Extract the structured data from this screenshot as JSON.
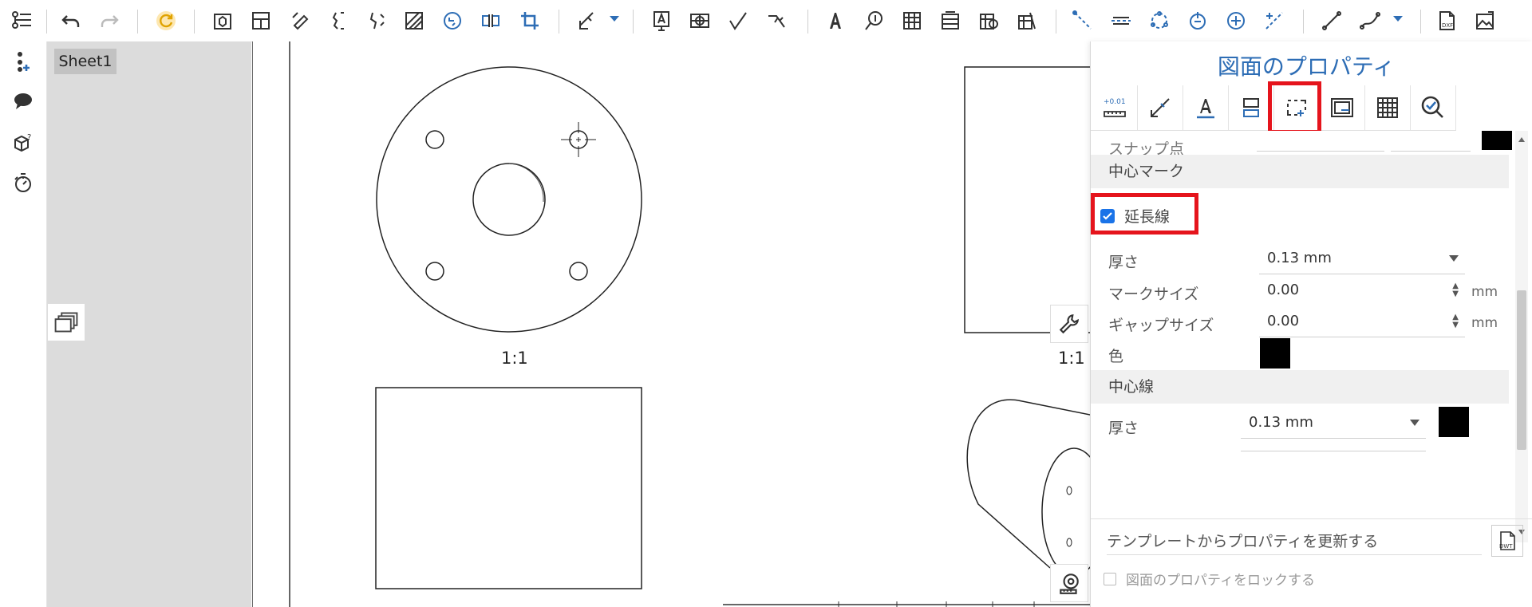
{
  "sheet": {
    "tab_label": "Sheet1"
  },
  "canvas": {
    "scale_label_left": "1:1",
    "scale_label_right": "1:1"
  },
  "properties": {
    "title": "図面のプロパティ",
    "tabs": [
      "tolerance-tab",
      "dimension-tab",
      "text-tab",
      "view-tab",
      "centermark-tab",
      "border-tab",
      "table-tab",
      "check-tab"
    ],
    "partial_row": {
      "label": "スナップ点"
    },
    "centermark": {
      "heading": "中心マーク",
      "extension_label": "延長線",
      "extension_checked": true,
      "thickness_label": "厚さ",
      "thickness_value": "0.13 mm",
      "marksize_label": "マークサイズ",
      "marksize_value": "0.00",
      "marksize_unit": "mm",
      "gapsize_label": "ギャップサイズ",
      "gapsize_value": "0.00",
      "gapsize_unit": "mm",
      "color_label": "色",
      "color": "#000000"
    },
    "centerline": {
      "heading": "中心線",
      "thickness_label": "厚さ",
      "thickness_value": "0.13 mm",
      "color": "#000000"
    },
    "update_from_template": "テンプレートからプロパティを更新する",
    "template_icon_text": "DWT",
    "lock_label": "図面のプロパティをロックする",
    "lock_checked": false
  },
  "colors": {
    "accent": "#2d6db5",
    "highlight": "#e5141c"
  }
}
